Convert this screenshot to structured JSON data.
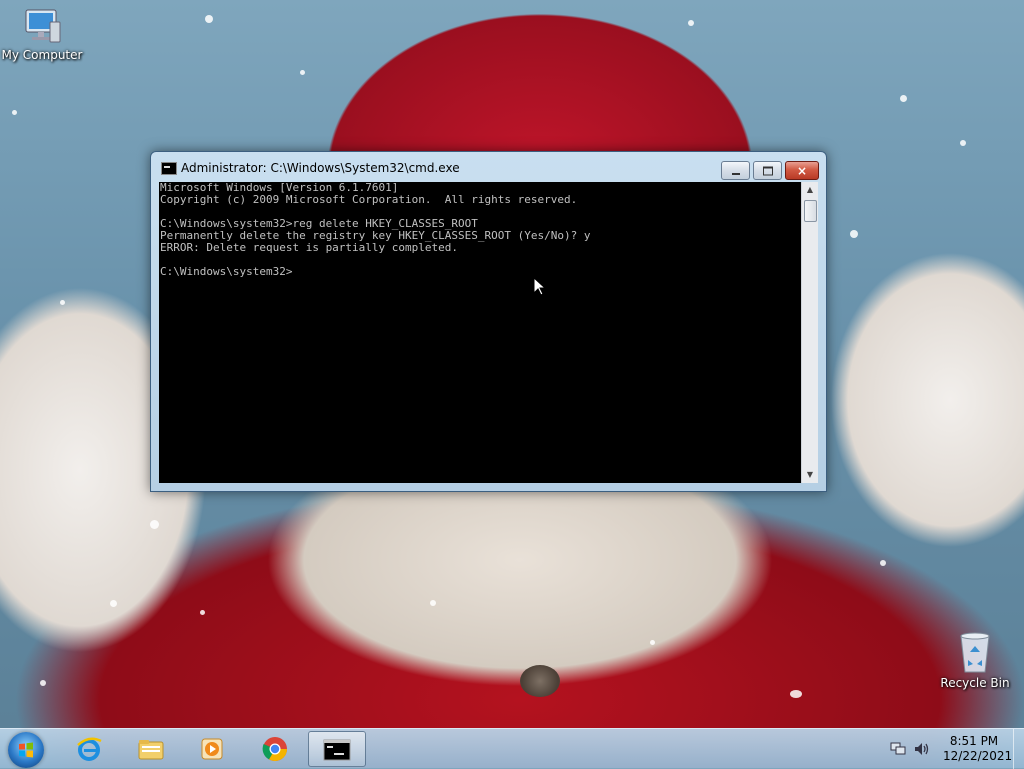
{
  "desktop": {
    "icons": [
      {
        "label": "My Computer"
      },
      {
        "label": "Recycle Bin"
      }
    ]
  },
  "window": {
    "title": "Administrator: C:\\Windows\\System32\\cmd.exe",
    "console_lines": [
      "Microsoft Windows [Version 6.1.7601]",
      "Copyright (c) 2009 Microsoft Corporation.  All rights reserved.",
      "",
      "C:\\Windows\\system32>reg delete HKEY_CLASSES_ROOT",
      "Permanently delete the registry key HKEY_CLASSES_ROOT (Yes/No)? y",
      "ERROR: Delete request is partially completed.",
      "",
      "C:\\Windows\\system32>"
    ],
    "controls": {
      "minimize": "minimize",
      "maximize": "maximize",
      "close": "×"
    }
  },
  "taskbar": {
    "pinned": [
      {
        "name": "Internet Explorer",
        "icon": "ie-icon"
      },
      {
        "name": "Windows Explorer",
        "icon": "folder-icon"
      },
      {
        "name": "Windows Media Player",
        "icon": "media-player-icon"
      },
      {
        "name": "Google Chrome",
        "icon": "chrome-icon"
      },
      {
        "name": "Command Prompt",
        "icon": "cmd-icon",
        "active": true
      }
    ],
    "clock": {
      "time": "8:51 PM",
      "date": "12/22/2021"
    }
  },
  "colors": {
    "console_bg": "#000000",
    "console_fg": "#c0c0c0",
    "taskbar": "#a9c6de"
  }
}
